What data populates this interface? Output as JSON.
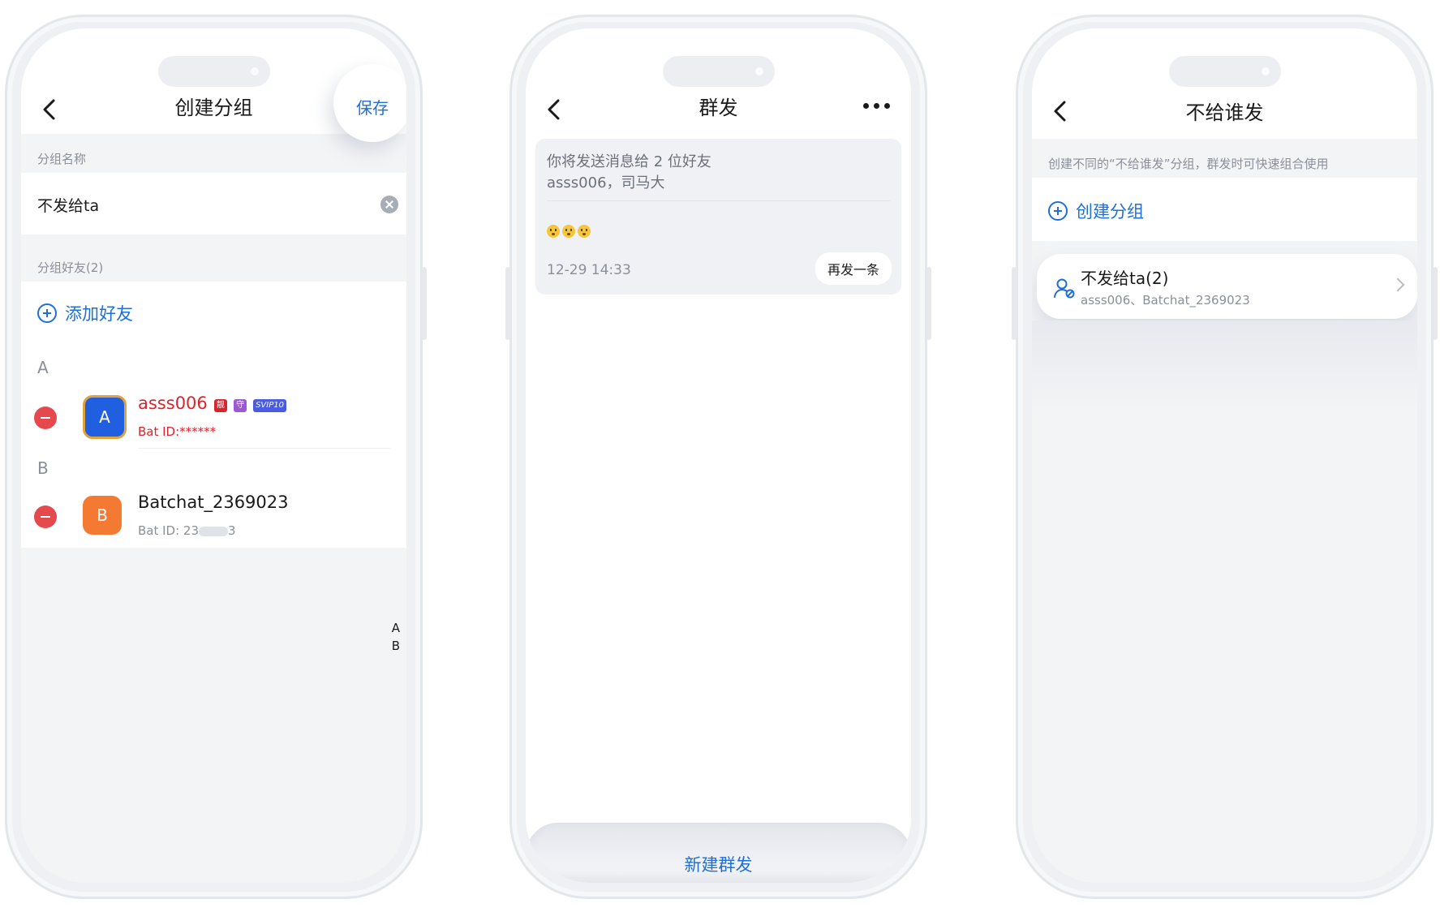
{
  "screen1": {
    "title": "创建分组",
    "save_label": "保存",
    "group_name_label": "分组名称",
    "group_name_value": "不发给ta",
    "members_label": "分组好友(2)",
    "add_friend_label": "添加好友",
    "index_a": "A",
    "index_b": "B",
    "contacts": [
      {
        "avatar_letter": "A",
        "name": "asss006",
        "badges": [
          "靓",
          "守",
          "SVIP10"
        ],
        "bat_id": "Bat ID:******"
      },
      {
        "avatar_letter": "B",
        "name": "Batchat_2369023",
        "bat_id": "Bat ID: 23",
        "bat_id_tail": "3"
      }
    ],
    "alpha_index": [
      "A",
      "B"
    ]
  },
  "screen2": {
    "title": "群发",
    "recipients_line1": "你将发送消息给 2 位好友",
    "recipients_line2": "asss006，司马大",
    "timestamp": "12-29 14:33",
    "resend_label": "再发一条",
    "new_broadcast_label": "新建群发"
  },
  "screen3": {
    "title": "不给谁发",
    "hint": "创建不同的“不给谁发”分组，群发时可快速组合使用",
    "create_group_label": "创建分组",
    "group_name": "不发给ta(2)",
    "group_members": "asss006、Batchat_2369023"
  },
  "colors": {
    "accent_blue": "#1f6fd6",
    "vip_red": "#d9242d",
    "delete_red": "#e5484d",
    "avatar_orange": "#f47a34",
    "avatar_blue": "#1f5fe0"
  }
}
